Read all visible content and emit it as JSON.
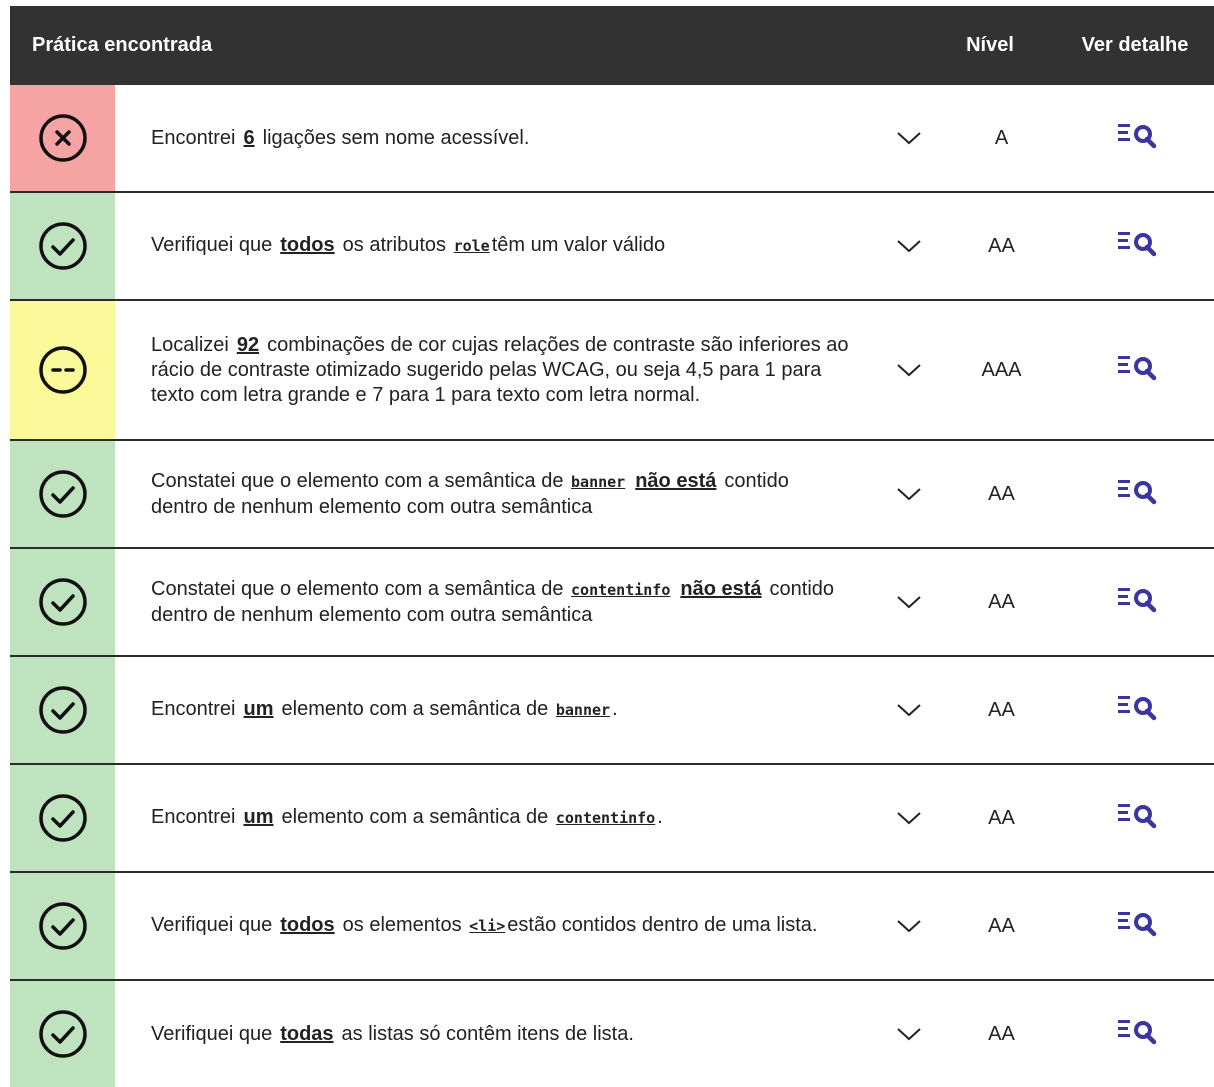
{
  "header": {
    "practice": "Prática encontrada",
    "level": "Nível",
    "detail": "Ver detalhe"
  },
  "colors": {
    "error": "#f5a3a3",
    "ok": "#bfe3bf",
    "warn": "#fafa9a",
    "header_bg": "#323232",
    "accent": "#3b35a0"
  },
  "rows": [
    {
      "status": "error",
      "icon": "error-x-icon",
      "parts": [
        "Encontrei",
        "6",
        "ligações sem nome acessível."
      ],
      "level": "A"
    },
    {
      "status": "ok",
      "icon": "check-icon",
      "parts": [
        "Verifiquei que",
        "todos",
        "os atributos",
        "role",
        "têm um valor válido"
      ],
      "level": "AA"
    },
    {
      "status": "warn",
      "icon": "neutral-dash-icon",
      "parts": [
        "Localizei",
        "92",
        "combinações de cor cujas relações de contraste são inferiores ao rácio de contraste otimizado sugerido pelas WCAG, ou seja 4,5 para 1 para texto com letra grande e 7 para 1 para texto com letra normal."
      ],
      "level": "AAA"
    },
    {
      "status": "ok",
      "icon": "check-icon",
      "parts": [
        "Constatei que o elemento com a semântica de",
        "banner",
        "não está",
        "contido dentro de nenhum elemento com outra semântica"
      ],
      "level": "AA"
    },
    {
      "status": "ok",
      "icon": "check-icon",
      "parts": [
        "Constatei que o elemento com a semântica de",
        "contentinfo",
        "não está",
        "contido dentro de nenhum elemento com outra semântica"
      ],
      "level": "AA"
    },
    {
      "status": "ok",
      "icon": "check-icon",
      "parts": [
        "Encontrei",
        "um",
        "elemento com a semântica de",
        "banner",
        "."
      ],
      "level": "AA"
    },
    {
      "status": "ok",
      "icon": "check-icon",
      "parts": [
        "Encontrei",
        "um",
        "elemento com a semântica de",
        "contentinfo",
        "."
      ],
      "level": "AA"
    },
    {
      "status": "ok",
      "icon": "check-icon",
      "parts": [
        "Verifiquei que",
        "todos",
        "os elementos",
        "<li>",
        "estão contidos dentro de uma lista."
      ],
      "level": "AA"
    },
    {
      "status": "ok",
      "icon": "check-icon",
      "parts": [
        "Verifiquei que",
        "todas",
        "as listas só contêm itens de lista."
      ],
      "level": "AA"
    }
  ]
}
